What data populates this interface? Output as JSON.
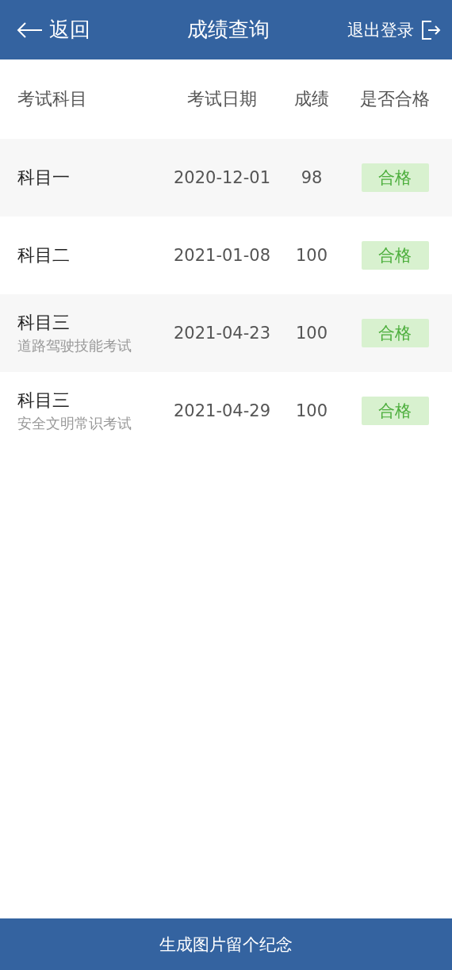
{
  "header": {
    "back": "返回",
    "title": "成绩查询",
    "logout": "退出登录"
  },
  "table": {
    "columns": [
      "考试科目",
      "考试日期",
      "成绩",
      "是否合格"
    ],
    "rows": [
      {
        "subject": "科目一",
        "date": "2020-12-01",
        "score": "98",
        "result": "合格",
        "passed": true
      },
      {
        "subject": "科目二",
        "date": "2021-01-08",
        "score": "100",
        "result": "合格",
        "passed": true
      },
      {
        "subject": "科目三",
        "note": "道路驾驶技能考试",
        "date": "2021-04-23",
        "score": "100",
        "result": "合格",
        "passed": true
      },
      {
        "subject": "科目三",
        "note": "安全文明常识考试",
        "date": "2021-04-29",
        "score": "100",
        "result": "合格",
        "passed": true
      }
    ]
  },
  "footer_button": "生成图片留个纪念"
}
